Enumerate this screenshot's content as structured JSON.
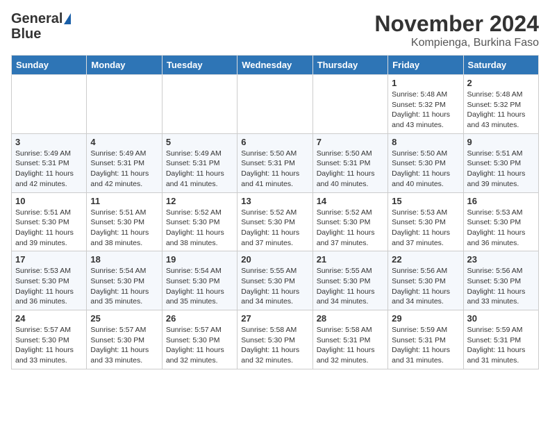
{
  "header": {
    "logo_line1": "General",
    "logo_line2": "Blue",
    "title": "November 2024",
    "subtitle": "Kompienga, Burkina Faso"
  },
  "calendar": {
    "days_of_week": [
      "Sunday",
      "Monday",
      "Tuesday",
      "Wednesday",
      "Thursday",
      "Friday",
      "Saturday"
    ],
    "weeks": [
      [
        {
          "day": "",
          "info": ""
        },
        {
          "day": "",
          "info": ""
        },
        {
          "day": "",
          "info": ""
        },
        {
          "day": "",
          "info": ""
        },
        {
          "day": "",
          "info": ""
        },
        {
          "day": "1",
          "info": "Sunrise: 5:48 AM\nSunset: 5:32 PM\nDaylight: 11 hours\nand 43 minutes."
        },
        {
          "day": "2",
          "info": "Sunrise: 5:48 AM\nSunset: 5:32 PM\nDaylight: 11 hours\nand 43 minutes."
        }
      ],
      [
        {
          "day": "3",
          "info": "Sunrise: 5:49 AM\nSunset: 5:31 PM\nDaylight: 11 hours\nand 42 minutes."
        },
        {
          "day": "4",
          "info": "Sunrise: 5:49 AM\nSunset: 5:31 PM\nDaylight: 11 hours\nand 42 minutes."
        },
        {
          "day": "5",
          "info": "Sunrise: 5:49 AM\nSunset: 5:31 PM\nDaylight: 11 hours\nand 41 minutes."
        },
        {
          "day": "6",
          "info": "Sunrise: 5:50 AM\nSunset: 5:31 PM\nDaylight: 11 hours\nand 41 minutes."
        },
        {
          "day": "7",
          "info": "Sunrise: 5:50 AM\nSunset: 5:31 PM\nDaylight: 11 hours\nand 40 minutes."
        },
        {
          "day": "8",
          "info": "Sunrise: 5:50 AM\nSunset: 5:30 PM\nDaylight: 11 hours\nand 40 minutes."
        },
        {
          "day": "9",
          "info": "Sunrise: 5:51 AM\nSunset: 5:30 PM\nDaylight: 11 hours\nand 39 minutes."
        }
      ],
      [
        {
          "day": "10",
          "info": "Sunrise: 5:51 AM\nSunset: 5:30 PM\nDaylight: 11 hours\nand 39 minutes."
        },
        {
          "day": "11",
          "info": "Sunrise: 5:51 AM\nSunset: 5:30 PM\nDaylight: 11 hours\nand 38 minutes."
        },
        {
          "day": "12",
          "info": "Sunrise: 5:52 AM\nSunset: 5:30 PM\nDaylight: 11 hours\nand 38 minutes."
        },
        {
          "day": "13",
          "info": "Sunrise: 5:52 AM\nSunset: 5:30 PM\nDaylight: 11 hours\nand 37 minutes."
        },
        {
          "day": "14",
          "info": "Sunrise: 5:52 AM\nSunset: 5:30 PM\nDaylight: 11 hours\nand 37 minutes."
        },
        {
          "day": "15",
          "info": "Sunrise: 5:53 AM\nSunset: 5:30 PM\nDaylight: 11 hours\nand 37 minutes."
        },
        {
          "day": "16",
          "info": "Sunrise: 5:53 AM\nSunset: 5:30 PM\nDaylight: 11 hours\nand 36 minutes."
        }
      ],
      [
        {
          "day": "17",
          "info": "Sunrise: 5:53 AM\nSunset: 5:30 PM\nDaylight: 11 hours\nand 36 minutes."
        },
        {
          "day": "18",
          "info": "Sunrise: 5:54 AM\nSunset: 5:30 PM\nDaylight: 11 hours\nand 35 minutes."
        },
        {
          "day": "19",
          "info": "Sunrise: 5:54 AM\nSunset: 5:30 PM\nDaylight: 11 hours\nand 35 minutes."
        },
        {
          "day": "20",
          "info": "Sunrise: 5:55 AM\nSunset: 5:30 PM\nDaylight: 11 hours\nand 34 minutes."
        },
        {
          "day": "21",
          "info": "Sunrise: 5:55 AM\nSunset: 5:30 PM\nDaylight: 11 hours\nand 34 minutes."
        },
        {
          "day": "22",
          "info": "Sunrise: 5:56 AM\nSunset: 5:30 PM\nDaylight: 11 hours\nand 34 minutes."
        },
        {
          "day": "23",
          "info": "Sunrise: 5:56 AM\nSunset: 5:30 PM\nDaylight: 11 hours\nand 33 minutes."
        }
      ],
      [
        {
          "day": "24",
          "info": "Sunrise: 5:57 AM\nSunset: 5:30 PM\nDaylight: 11 hours\nand 33 minutes."
        },
        {
          "day": "25",
          "info": "Sunrise: 5:57 AM\nSunset: 5:30 PM\nDaylight: 11 hours\nand 33 minutes."
        },
        {
          "day": "26",
          "info": "Sunrise: 5:57 AM\nSunset: 5:30 PM\nDaylight: 11 hours\nand 32 minutes."
        },
        {
          "day": "27",
          "info": "Sunrise: 5:58 AM\nSunset: 5:30 PM\nDaylight: 11 hours\nand 32 minutes."
        },
        {
          "day": "28",
          "info": "Sunrise: 5:58 AM\nSunset: 5:31 PM\nDaylight: 11 hours\nand 32 minutes."
        },
        {
          "day": "29",
          "info": "Sunrise: 5:59 AM\nSunset: 5:31 PM\nDaylight: 11 hours\nand 31 minutes."
        },
        {
          "day": "30",
          "info": "Sunrise: 5:59 AM\nSunset: 5:31 PM\nDaylight: 11 hours\nand 31 minutes."
        }
      ]
    ]
  }
}
